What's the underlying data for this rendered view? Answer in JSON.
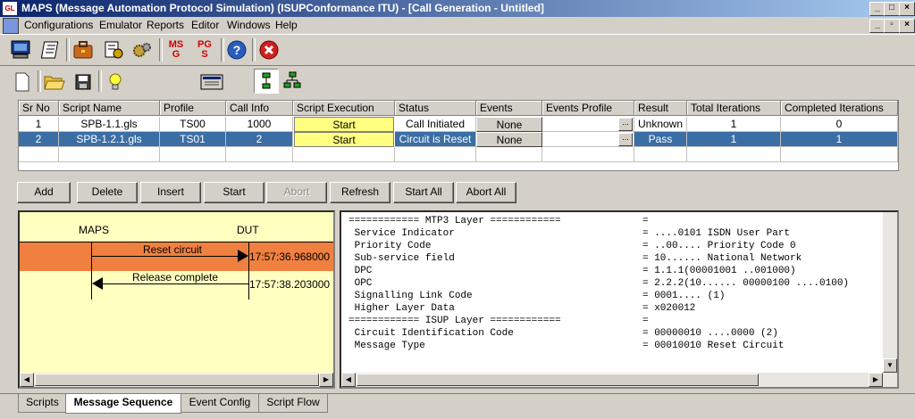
{
  "window": {
    "title": "MAPS (Message Automation Protocol Simulation)  (ISUPConformance ITU) - [Call Generation - Untitled]",
    "app_icon_text": "GL"
  },
  "menu": [
    "Configurations",
    "Emulator",
    "Reports",
    "Editor",
    "Windows",
    "Help"
  ],
  "toolbar_main": {
    "msg_label_top": "MS",
    "msg_label_bottom": "G",
    "pgs_label_top": "PG",
    "pgs_label_bottom": "S",
    "help_label": "?"
  },
  "table": {
    "columns": [
      "Sr No",
      "Script Name",
      "Profile",
      "Call Info",
      "Script Execution",
      "Status",
      "Events",
      "Events Profile",
      "Result",
      "Total Iterations",
      "Completed Iterations"
    ],
    "rows": [
      {
        "sr": "1",
        "script": "SPB-1.1.gls",
        "profile": "TS00",
        "call_info": "1000",
        "exec": "Start",
        "status": "Call Initiated",
        "events": "None",
        "events_profile": "...",
        "result": "Unknown",
        "total": "1",
        "completed": "0"
      },
      {
        "sr": "2",
        "script": "SPB-1.2.1.gls",
        "profile": "TS01",
        "call_info": "2",
        "exec": "Start",
        "status": "Circuit is Reset",
        "events": "None",
        "events_profile": "...",
        "result": "Pass",
        "total": "1",
        "completed": "1"
      }
    ]
  },
  "buttons": {
    "add": "Add",
    "delete": "Delete",
    "insert": "Insert",
    "start": "Start",
    "abort": "Abort",
    "refresh": "Refresh",
    "start_all": "Start All",
    "abort_all": "Abort All"
  },
  "sequence": {
    "left_entity": "MAPS",
    "right_entity": "DUT",
    "messages": [
      {
        "label": "Reset circuit",
        "time": "17:57:36.968000",
        "direction": "right",
        "highlighted": true
      },
      {
        "label": "Release complete",
        "time": "17:57:38.203000",
        "direction": "left",
        "highlighted": false
      }
    ]
  },
  "decode": {
    "lines": [
      {
        "field": "============ MTP3 Layer ============",
        "value": "="
      },
      {
        "field": " Service Indicator",
        "value": "= ....0101 ISDN User Part"
      },
      {
        "field": " Priority Code",
        "value": "= ..00.... Priority Code 0"
      },
      {
        "field": " Sub-service field",
        "value": "= 10...... National Network"
      },
      {
        "field": " DPC",
        "value": "= 1.1.1(00001001 ..001000)"
      },
      {
        "field": " OPC",
        "value": "= 2.2.2(10...... 00000100 ....0100)"
      },
      {
        "field": " Signalling Link Code",
        "value": "= 0001.... (1)"
      },
      {
        "field": " Higher Layer Data",
        "value": "= x020012"
      },
      {
        "field": "============ ISUP Layer ============",
        "value": "="
      },
      {
        "field": " Circuit Identification Code",
        "value": "= 00000010 ....0000 (2)"
      },
      {
        "field": " Message Type",
        "value": "= 00010010 Reset Circuit"
      }
    ]
  },
  "tabs": [
    "Scripts",
    "Message Sequence",
    "Event Config",
    "Script Flow"
  ],
  "colors": {
    "title_start": "#0a246a",
    "selection": "#3a6ea5",
    "exec_cell": "#ffff80",
    "sequence_bg": "#ffffc0",
    "highlight_row": "#f08040"
  }
}
